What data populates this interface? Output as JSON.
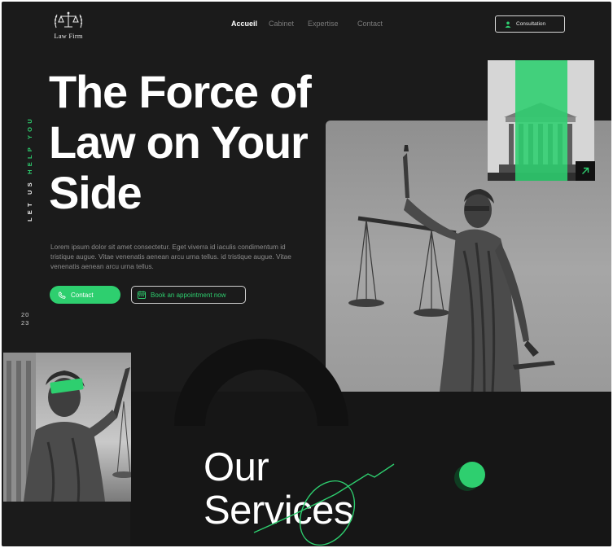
{
  "header": {
    "logo_text": "Law Firm",
    "nav": [
      {
        "label": "Accueil",
        "active": true
      },
      {
        "label": "Cabinet",
        "active": false
      },
      {
        "label": "Expertise",
        "active": false
      },
      {
        "label": "Contact",
        "active": false
      }
    ],
    "consultation_label": "Consultation"
  },
  "side": {
    "text_prefix": "LET US ",
    "text_highlight": "HELP YOU",
    "year_top": "20",
    "year_bottom": "23"
  },
  "hero": {
    "title_line1": "The Force of",
    "title_line2": "Law on Your",
    "title_line3": "Side",
    "description": "Lorem ipsum dolor sit amet consectetur. Eget viverra id iaculis condimentum id tristique augue. Vitae venenatis aenean arcu urna tellus. id tristique augue. Vitae venenatis aenean arcu urna tellus.",
    "contact_label": "Contact",
    "book_label": "Book an appointment now"
  },
  "services": {
    "title_line1": "Our",
    "title_line2": "Services"
  },
  "colors": {
    "accent": "#2ecf6f",
    "background": "#1b1b1b",
    "text": "#ffffff"
  },
  "icons": [
    "scales-logo-icon",
    "user-icon",
    "phone-icon",
    "calendar-icon",
    "arrow-up-right-icon"
  ]
}
